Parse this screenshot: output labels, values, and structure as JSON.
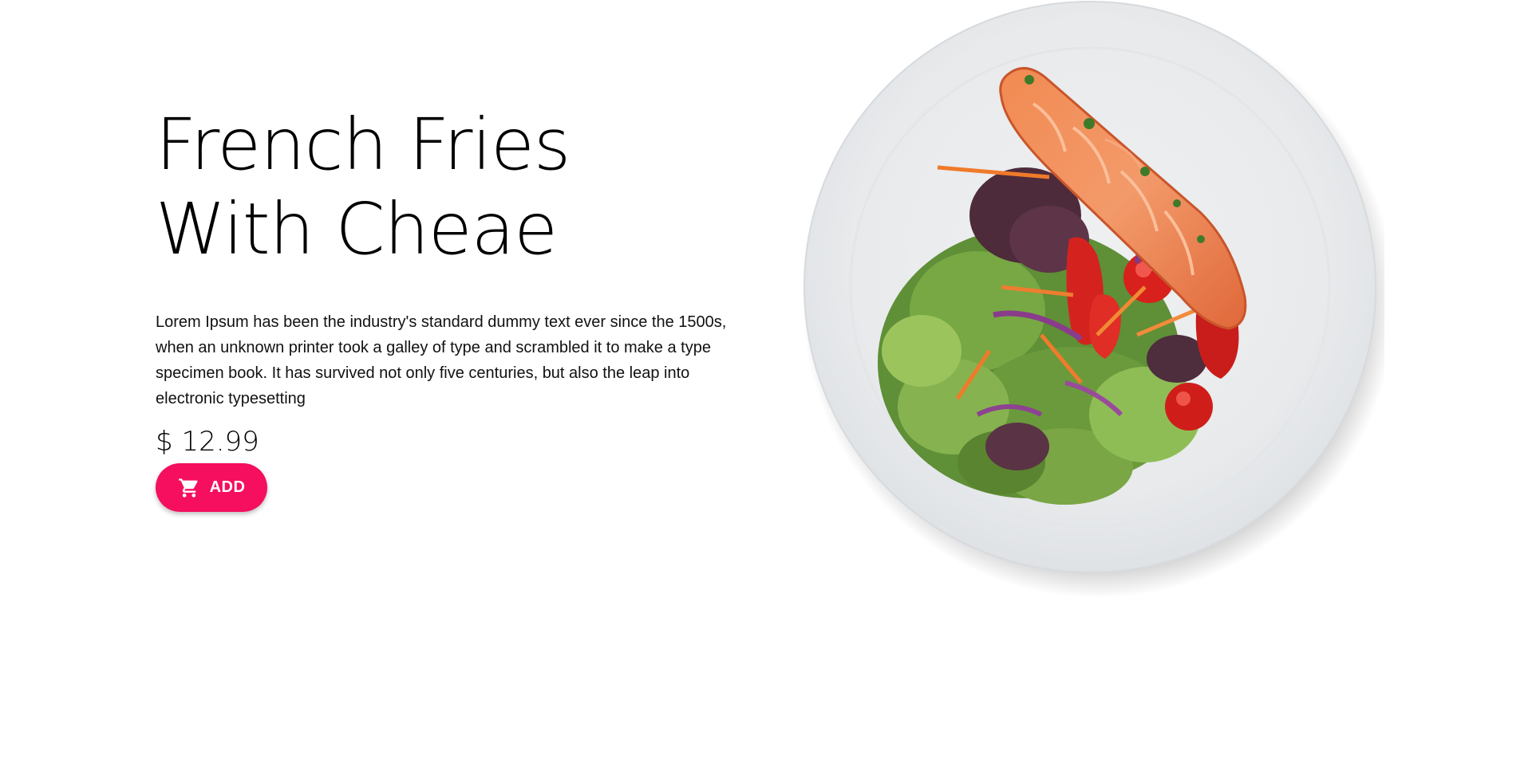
{
  "product": {
    "title": "French Fries With Cheae",
    "description": "Lorem Ipsum has been the industry's standard dummy text ever since the 1500s, when an unknown printer took a galley of type and scrambled it to make a type specimen book. It has survived not only five centuries, but also the leap into electronic typesetting",
    "price": "$ 12.99",
    "add_label": "ADD",
    "add_icon": "shopping-cart-icon",
    "image": "plate-of-salmon-salad-image"
  },
  "colors": {
    "accent": "#f50f5e",
    "plate": "#e9ecee",
    "background": "#ffffff"
  }
}
